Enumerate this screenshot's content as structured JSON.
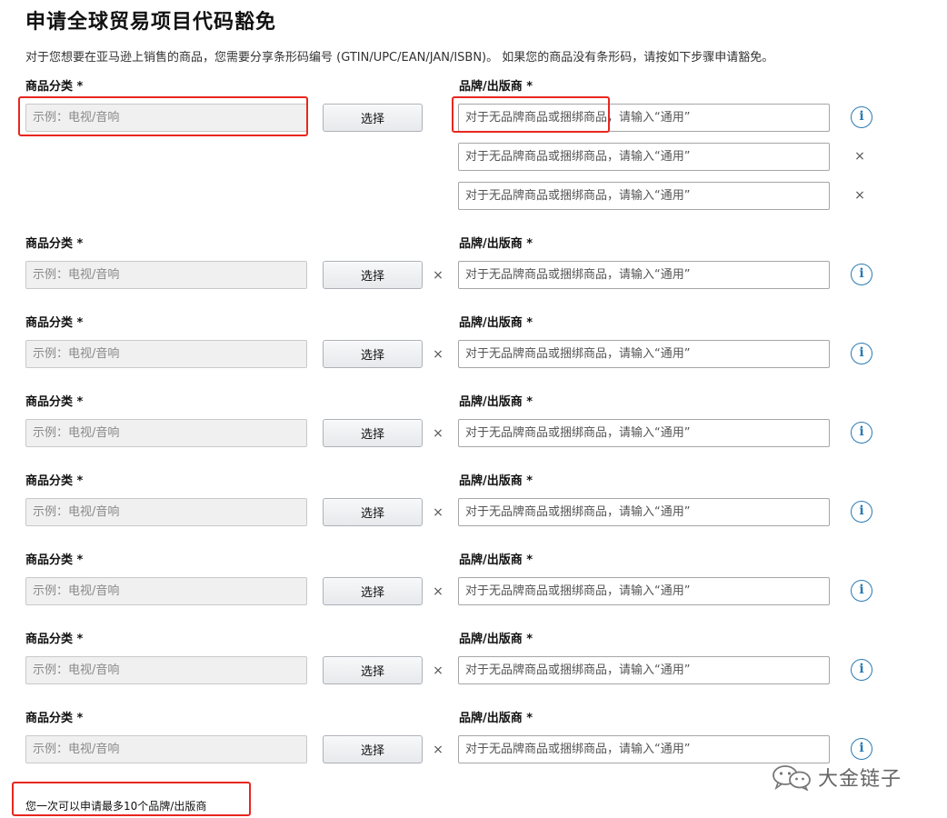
{
  "page": {
    "title": "申请全球贸易项目代码豁免",
    "description": "对于您想要在亚马逊上销售的商品，您需要分享条形码编号 (GTIN/UPC/EAN/JAN/ISBN)。 如果您的商品没有条形码，请按如下步骤申请豁免。",
    "footer_note": "您一次可以申请最多10个品牌/出版商",
    "watermark": "大金链子"
  },
  "form": {
    "category_label": "商品分类 *",
    "brand_label": "品牌/出版商 *",
    "category_placeholder": "示例：电视/音响",
    "brand_placeholder": "对于无品牌商品或捆绑商品，请输入“通用”",
    "select_button": "选择",
    "remove_symbol": "×",
    "info_symbol": "i"
  },
  "colors": {
    "annotation": "#e8271f",
    "info_accent": "#2a7ab3",
    "disabled_field": "#f0f0f0"
  },
  "icons": {
    "remove": "close-icon",
    "info": "info-icon",
    "watermark": "wechat-icon"
  }
}
